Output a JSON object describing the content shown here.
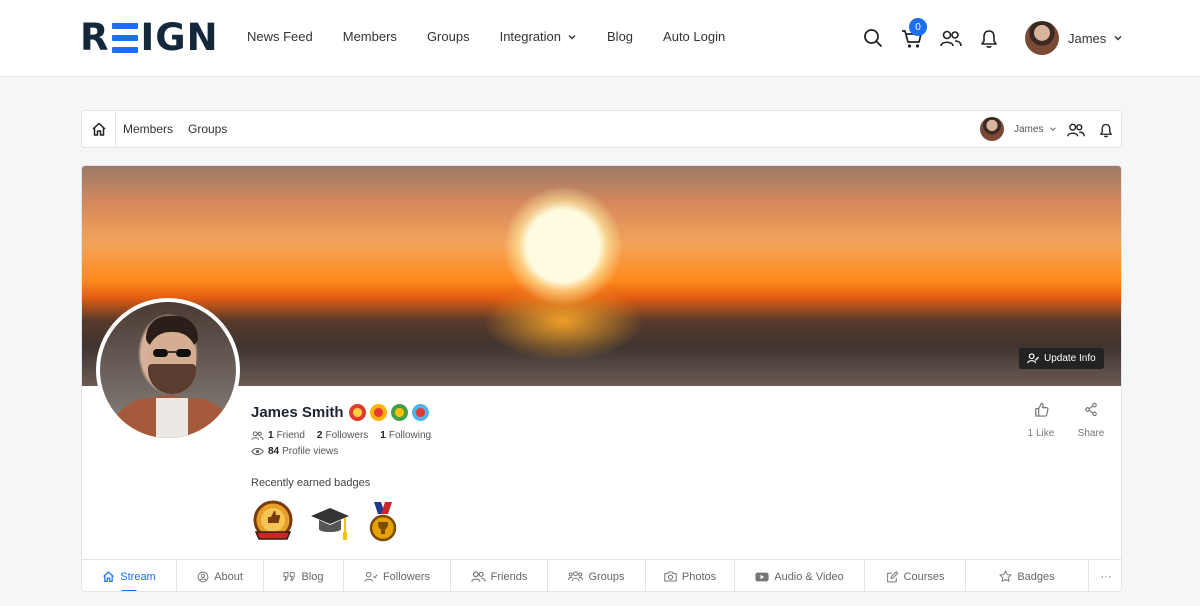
{
  "header": {
    "logo": {
      "left": "R",
      "right": "IGN"
    },
    "nav": [
      "News Feed",
      "Members",
      "Groups",
      "Integration",
      "Blog",
      "Auto Login"
    ],
    "cart_count": "0",
    "user_name": "James"
  },
  "subbar": {
    "links": [
      "Members",
      "Groups"
    ],
    "user_name": "James"
  },
  "profile": {
    "update_info": "Update Info",
    "name": "James Smith",
    "friends_count": "1",
    "friends_label": "Friend",
    "followers_count": "2",
    "followers_label": "Followers",
    "following_count": "1",
    "following_label": "Following",
    "views_count": "84",
    "views_label": "Profile views",
    "badges_title": "Recently earned badges",
    "like_label": "1 Like",
    "share_label": "Share"
  },
  "tabs": [
    "Stream",
    "About",
    "Blog",
    "Followers",
    "Friends",
    "Groups",
    "Photos",
    "Audio & Video",
    "Courses",
    "Badges",
    "···"
  ],
  "colors": {
    "accent": "#1d6ff2",
    "dark": "#13283a"
  }
}
